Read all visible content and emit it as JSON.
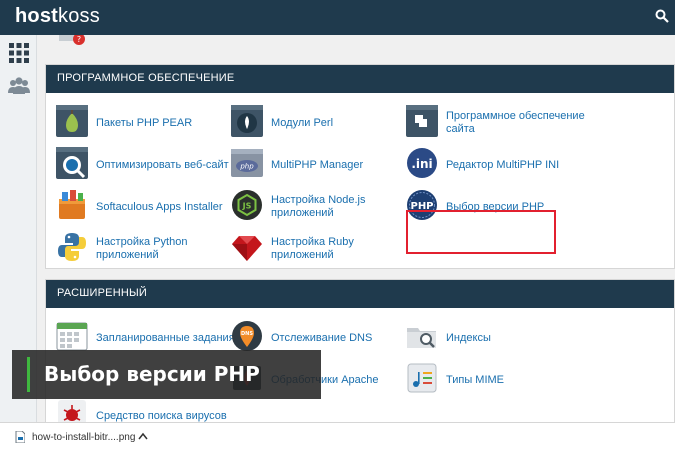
{
  "brand": {
    "logo_bold": "host",
    "logo_light": "koss"
  },
  "sections": [
    {
      "title": "ПРОГРАММНОЕ ОБЕСПЕЧЕНИЕ",
      "items": [
        {
          "label": "Пакеты PHP PEAR",
          "icon": "php-pear-icon"
        },
        {
          "label": "Модули Perl",
          "icon": "perl-modules-icon"
        },
        {
          "label": "Программное обеспечение сайта",
          "icon": "site-software-icon"
        },
        {
          "label": "Оптимизировать веб-сайт",
          "icon": "optimize-website-icon"
        },
        {
          "label": "MultiPHP Manager",
          "icon": "multiphp-manager-icon"
        },
        {
          "label": "Редактор MultiPHP INI",
          "icon": "multiphp-ini-editor-icon"
        },
        {
          "label": "Softaculous Apps Installer",
          "icon": "softaculous-icon"
        },
        {
          "label": "Настройка Node.js приложений",
          "icon": "nodejs-icon"
        },
        {
          "label": "Выбор версии PHP",
          "icon": "php-version-icon"
        },
        {
          "label": "Настройка Python приложений",
          "icon": "python-icon"
        },
        {
          "label": "Настройка Ruby приложений",
          "icon": "ruby-icon"
        }
      ]
    },
    {
      "title": "РАСШИРЕННЫЙ",
      "items": [
        {
          "label": "Запланированные задания",
          "icon": "cron-jobs-icon"
        },
        {
          "label": "Отслеживание DNS",
          "icon": "dns-tracking-icon"
        },
        {
          "label": "Индексы",
          "icon": "indexes-icon"
        },
        {
          "label": "Обработчики Apache",
          "icon": "apache-handlers-icon"
        },
        {
          "label": "Типы MIME",
          "icon": "mime-types-icon"
        },
        {
          "label": "Средство поиска вирусов",
          "icon": "virus-scanner-icon"
        }
      ]
    }
  ],
  "overlay_caption": "Выбор версии PHP",
  "downloads": {
    "file_name": "how-to-install-bitr....png"
  },
  "colors": {
    "topbar": "#1f3a4d",
    "link": "#1a6fae",
    "highlight": "#e2202f",
    "caption_accent": "#3fb83f"
  }
}
